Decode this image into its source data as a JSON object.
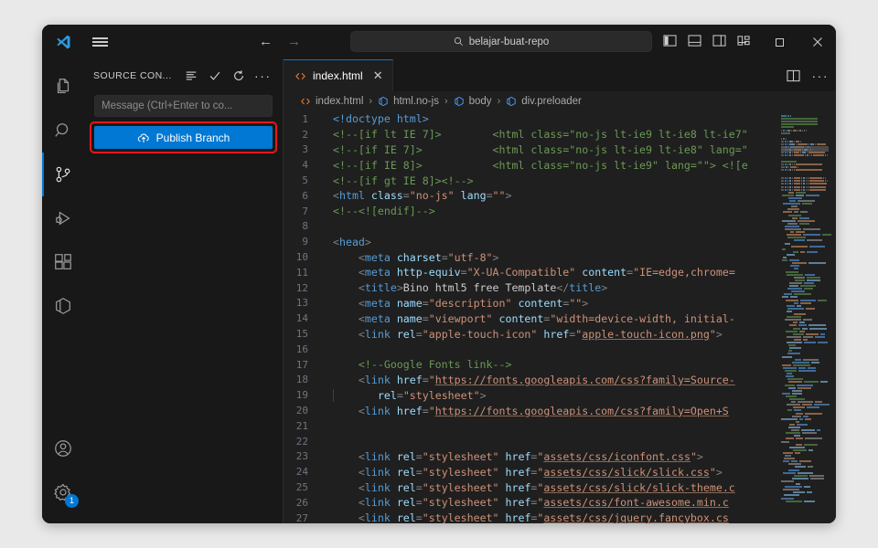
{
  "app": {
    "name": "Visual Studio Code"
  },
  "titlebar": {
    "logo_icon": "vscode-logo-icon",
    "menu_icon": "hamburger-menu-icon",
    "back_label": "←",
    "forward_label": "→",
    "search": {
      "icon": "search-icon",
      "value": "belajar-buat-repo",
      "placeholder": "Search"
    },
    "layout_icons": [
      {
        "name": "toggle-primary-sidebar-icon"
      },
      {
        "name": "toggle-panel-icon"
      },
      {
        "name": "toggle-secondary-sidebar-icon"
      },
      {
        "name": "customize-layout-icon"
      }
    ],
    "window_controls": [
      {
        "name": "minimize-button",
        "glyph": "—"
      },
      {
        "name": "maximize-button",
        "glyph": "□"
      },
      {
        "name": "close-button",
        "glyph": "✕"
      }
    ]
  },
  "activitybar": {
    "items": [
      {
        "name": "explorer",
        "icon": "files-icon",
        "active": false
      },
      {
        "name": "search",
        "icon": "search-icon",
        "active": false
      },
      {
        "name": "source-control",
        "icon": "source-control-icon",
        "active": true
      },
      {
        "name": "run-and-debug",
        "icon": "run-debug-icon",
        "active": false
      },
      {
        "name": "extensions",
        "icon": "extensions-icon",
        "active": false
      },
      {
        "name": "remote-explorer",
        "icon": "cube-icon",
        "active": false
      }
    ],
    "bottom": [
      {
        "name": "accounts",
        "icon": "account-icon",
        "badge": ""
      },
      {
        "name": "manage",
        "icon": "gear-icon",
        "badge": "1"
      }
    ]
  },
  "sidebar": {
    "title": "SOURCE CON...",
    "actions": [
      {
        "name": "view-as-list-icon"
      },
      {
        "name": "commit-check-icon"
      },
      {
        "name": "refresh-icon"
      },
      {
        "name": "more-actions-icon"
      }
    ],
    "commit_input": {
      "placeholder": "Message (Ctrl+Enter to co..."
    },
    "publish_button": {
      "label": "Publish Branch",
      "icon": "cloud-upload-icon",
      "color": "#0078d4",
      "highlighted": true
    },
    "highlight_color": "#e81717"
  },
  "editor": {
    "tab": {
      "label": "index.html",
      "icon": "html-file-icon",
      "close": "✕",
      "active": true
    },
    "tab_actions": [
      {
        "name": "split-editor-icon"
      },
      {
        "name": "more-editor-actions-icon",
        "glyph": "⋯"
      }
    ],
    "breadcrumb": [
      {
        "label": "index.html",
        "icon": "html-file-icon"
      },
      {
        "label": "html.no-js",
        "icon": "symbol-field-icon"
      },
      {
        "label": "body",
        "icon": "symbol-field-icon"
      },
      {
        "label": "div.preloader",
        "icon": "symbol-field-icon"
      }
    ],
    "breadcrumb_separator": "›",
    "first_line": 1,
    "lines": [
      {
        "n": 1,
        "tokens": [
          {
            "t": "doc",
            "v": "<!doctype "
          },
          {
            "t": "tag",
            "v": "html"
          },
          {
            "t": "doc",
            "v": ">"
          }
        ]
      },
      {
        "n": 2,
        "tokens": [
          {
            "t": "cmt",
            "v": "<!--[if lt IE 7]>        <html class=\"no-js lt-ie9 lt-ie8 lt-ie7\""
          }
        ]
      },
      {
        "n": 3,
        "tokens": [
          {
            "t": "cmt",
            "v": "<!--[if IE 7]>           <html class=\"no-js lt-ie9 lt-ie8\" lang=\""
          }
        ]
      },
      {
        "n": 4,
        "tokens": [
          {
            "t": "cmt",
            "v": "<!--[if IE 8]>           <html class=\"no-js lt-ie9\" lang=\"\"> <![e"
          }
        ]
      },
      {
        "n": 5,
        "tokens": [
          {
            "t": "cmt",
            "v": "<!--[if gt IE 8]><!-->"
          }
        ]
      },
      {
        "n": 6,
        "tokens": [
          {
            "t": "punct",
            "v": "<"
          },
          {
            "t": "tag",
            "v": "html"
          },
          {
            "t": "txt",
            "v": " "
          },
          {
            "t": "attr",
            "v": "class"
          },
          {
            "t": "punct",
            "v": "="
          },
          {
            "t": "str",
            "v": "\"no-js\""
          },
          {
            "t": "txt",
            "v": " "
          },
          {
            "t": "attr",
            "v": "lang"
          },
          {
            "t": "punct",
            "v": "="
          },
          {
            "t": "str",
            "v": "\"\""
          },
          {
            "t": "punct",
            "v": ">"
          }
        ]
      },
      {
        "n": 7,
        "tokens": [
          {
            "t": "cmt",
            "v": "<!--<![endif]-->"
          }
        ]
      },
      {
        "n": 8,
        "tokens": []
      },
      {
        "n": 9,
        "tokens": [
          {
            "t": "punct",
            "v": "<"
          },
          {
            "t": "tag",
            "v": "head"
          },
          {
            "t": "punct",
            "v": ">"
          }
        ]
      },
      {
        "n": 10,
        "tokens": [
          {
            "t": "punct",
            "v": "    <"
          },
          {
            "t": "tag",
            "v": "meta"
          },
          {
            "t": "txt",
            "v": " "
          },
          {
            "t": "attr",
            "v": "charset"
          },
          {
            "t": "punct",
            "v": "="
          },
          {
            "t": "str",
            "v": "\"utf-8\""
          },
          {
            "t": "punct",
            "v": ">"
          }
        ]
      },
      {
        "n": 11,
        "tokens": [
          {
            "t": "punct",
            "v": "    <"
          },
          {
            "t": "tag",
            "v": "meta"
          },
          {
            "t": "txt",
            "v": " "
          },
          {
            "t": "attr",
            "v": "http-equiv"
          },
          {
            "t": "punct",
            "v": "="
          },
          {
            "t": "str",
            "v": "\"X-UA-Compatible\""
          },
          {
            "t": "txt",
            "v": " "
          },
          {
            "t": "attr",
            "v": "content"
          },
          {
            "t": "punct",
            "v": "="
          },
          {
            "t": "str",
            "v": "\"IE=edge,chrome="
          }
        ]
      },
      {
        "n": 12,
        "tokens": [
          {
            "t": "punct",
            "v": "    <"
          },
          {
            "t": "tag",
            "v": "title"
          },
          {
            "t": "punct",
            "v": ">"
          },
          {
            "t": "txt",
            "v": "Bino html5 free Template"
          },
          {
            "t": "punct",
            "v": "</"
          },
          {
            "t": "tag",
            "v": "title"
          },
          {
            "t": "punct",
            "v": ">"
          }
        ]
      },
      {
        "n": 13,
        "tokens": [
          {
            "t": "punct",
            "v": "    <"
          },
          {
            "t": "tag",
            "v": "meta"
          },
          {
            "t": "txt",
            "v": " "
          },
          {
            "t": "attr",
            "v": "name"
          },
          {
            "t": "punct",
            "v": "="
          },
          {
            "t": "str",
            "v": "\"description\""
          },
          {
            "t": "txt",
            "v": " "
          },
          {
            "t": "attr",
            "v": "content"
          },
          {
            "t": "punct",
            "v": "="
          },
          {
            "t": "str",
            "v": "\"\""
          },
          {
            "t": "punct",
            "v": ">"
          }
        ]
      },
      {
        "n": 14,
        "tokens": [
          {
            "t": "punct",
            "v": "    <"
          },
          {
            "t": "tag",
            "v": "meta"
          },
          {
            "t": "txt",
            "v": " "
          },
          {
            "t": "attr",
            "v": "name"
          },
          {
            "t": "punct",
            "v": "="
          },
          {
            "t": "str",
            "v": "\"viewport\""
          },
          {
            "t": "txt",
            "v": " "
          },
          {
            "t": "attr",
            "v": "content"
          },
          {
            "t": "punct",
            "v": "="
          },
          {
            "t": "str",
            "v": "\"width=device-width, initial-"
          }
        ]
      },
      {
        "n": 15,
        "tokens": [
          {
            "t": "punct",
            "v": "    <"
          },
          {
            "t": "tag",
            "v": "link"
          },
          {
            "t": "txt",
            "v": " "
          },
          {
            "t": "attr",
            "v": "rel"
          },
          {
            "t": "punct",
            "v": "="
          },
          {
            "t": "str",
            "v": "\"apple-touch-icon\""
          },
          {
            "t": "txt",
            "v": " "
          },
          {
            "t": "attr",
            "v": "href"
          },
          {
            "t": "punct",
            "v": "="
          },
          {
            "t": "str",
            "v": "\""
          },
          {
            "t": "link",
            "v": "apple-touch-icon.png"
          },
          {
            "t": "str",
            "v": "\""
          },
          {
            "t": "punct",
            "v": ">"
          }
        ]
      },
      {
        "n": 16,
        "tokens": []
      },
      {
        "n": 17,
        "tokens": [
          {
            "t": "cmt",
            "v": "    <!--Google Fonts link-->"
          }
        ]
      },
      {
        "n": 18,
        "tokens": [
          {
            "t": "punct",
            "v": "    <"
          },
          {
            "t": "tag",
            "v": "link"
          },
          {
            "t": "txt",
            "v": " "
          },
          {
            "t": "attr",
            "v": "href"
          },
          {
            "t": "punct",
            "v": "="
          },
          {
            "t": "str",
            "v": "\""
          },
          {
            "t": "link",
            "v": "https://fonts.googleapis.com/css?family=Source-"
          }
        ]
      },
      {
        "n": 19,
        "tokens": [
          {
            "t": "punct",
            "v": "       "
          },
          {
            "t": "attr",
            "v": "rel"
          },
          {
            "t": "punct",
            "v": "="
          },
          {
            "t": "str",
            "v": "\"stylesheet\""
          },
          {
            "t": "punct",
            "v": ">"
          }
        ]
      },
      {
        "n": 20,
        "tokens": [
          {
            "t": "punct",
            "v": "    <"
          },
          {
            "t": "tag",
            "v": "link"
          },
          {
            "t": "txt",
            "v": " "
          },
          {
            "t": "attr",
            "v": "href"
          },
          {
            "t": "punct",
            "v": "="
          },
          {
            "t": "str",
            "v": "\""
          },
          {
            "t": "link",
            "v": "https://fonts.googleapis.com/css?family=Open+S"
          }
        ]
      },
      {
        "n": 21,
        "tokens": []
      },
      {
        "n": 22,
        "tokens": []
      },
      {
        "n": 23,
        "tokens": [
          {
            "t": "punct",
            "v": "    <"
          },
          {
            "t": "tag",
            "v": "link"
          },
          {
            "t": "txt",
            "v": " "
          },
          {
            "t": "attr",
            "v": "rel"
          },
          {
            "t": "punct",
            "v": "="
          },
          {
            "t": "str",
            "v": "\"stylesheet\""
          },
          {
            "t": "txt",
            "v": " "
          },
          {
            "t": "attr",
            "v": "href"
          },
          {
            "t": "punct",
            "v": "="
          },
          {
            "t": "str",
            "v": "\""
          },
          {
            "t": "link",
            "v": "assets/css/iconfont.css"
          },
          {
            "t": "str",
            "v": "\""
          },
          {
            "t": "punct",
            "v": ">"
          }
        ]
      },
      {
        "n": 24,
        "tokens": [
          {
            "t": "punct",
            "v": "    <"
          },
          {
            "t": "tag",
            "v": "link"
          },
          {
            "t": "txt",
            "v": " "
          },
          {
            "t": "attr",
            "v": "rel"
          },
          {
            "t": "punct",
            "v": "="
          },
          {
            "t": "str",
            "v": "\"stylesheet\""
          },
          {
            "t": "txt",
            "v": " "
          },
          {
            "t": "attr",
            "v": "href"
          },
          {
            "t": "punct",
            "v": "="
          },
          {
            "t": "str",
            "v": "\""
          },
          {
            "t": "link",
            "v": "assets/css/slick/slick.css"
          },
          {
            "t": "str",
            "v": "\""
          },
          {
            "t": "punct",
            "v": ">"
          }
        ]
      },
      {
        "n": 25,
        "tokens": [
          {
            "t": "punct",
            "v": "    <"
          },
          {
            "t": "tag",
            "v": "link"
          },
          {
            "t": "txt",
            "v": " "
          },
          {
            "t": "attr",
            "v": "rel"
          },
          {
            "t": "punct",
            "v": "="
          },
          {
            "t": "str",
            "v": "\"stylesheet\""
          },
          {
            "t": "txt",
            "v": " "
          },
          {
            "t": "attr",
            "v": "href"
          },
          {
            "t": "punct",
            "v": "="
          },
          {
            "t": "str",
            "v": "\""
          },
          {
            "t": "link",
            "v": "assets/css/slick/slick-theme.c"
          }
        ]
      },
      {
        "n": 26,
        "tokens": [
          {
            "t": "punct",
            "v": "    <"
          },
          {
            "t": "tag",
            "v": "link"
          },
          {
            "t": "txt",
            "v": " "
          },
          {
            "t": "attr",
            "v": "rel"
          },
          {
            "t": "punct",
            "v": "="
          },
          {
            "t": "str",
            "v": "\"stylesheet\""
          },
          {
            "t": "txt",
            "v": " "
          },
          {
            "t": "attr",
            "v": "href"
          },
          {
            "t": "punct",
            "v": "="
          },
          {
            "t": "str",
            "v": "\""
          },
          {
            "t": "link",
            "v": "assets/css/font-awesome.min.c"
          }
        ]
      },
      {
        "n": 27,
        "tokens": [
          {
            "t": "punct",
            "v": "    <"
          },
          {
            "t": "tag",
            "v": "link"
          },
          {
            "t": "txt",
            "v": " "
          },
          {
            "t": "attr",
            "v": "rel"
          },
          {
            "t": "punct",
            "v": "="
          },
          {
            "t": "str",
            "v": "\"stylesheet\""
          },
          {
            "t": "txt",
            "v": " "
          },
          {
            "t": "attr",
            "v": "href"
          },
          {
            "t": "punct",
            "v": "="
          },
          {
            "t": "str",
            "v": "\""
          },
          {
            "t": "link",
            "v": "assets/css/jquery.fancybox.cs"
          }
        ]
      }
    ]
  },
  "theme": {
    "accent": "#0078d4",
    "editor_bg": "#1f1f1f",
    "chrome_bg": "#181818",
    "page_bg": "#e9e9e9"
  }
}
